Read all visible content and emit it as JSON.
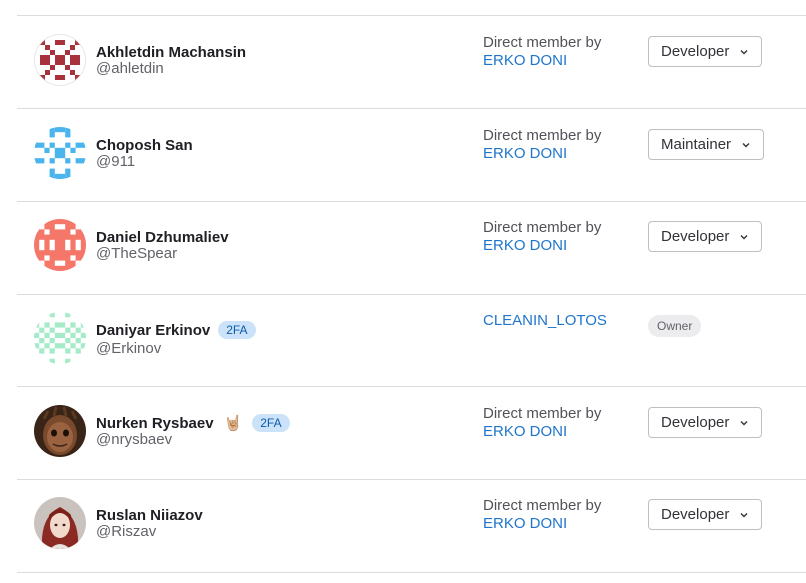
{
  "members": [
    {
      "name": "Akhletdin Machansin",
      "username": "@ahletdin",
      "source_text": "Direct member by",
      "source_link": "ERKO DONI",
      "role": "Developer",
      "badges": [],
      "avatar": "identicon-red-ornament"
    },
    {
      "name": "Choposh San",
      "username": "@911",
      "source_text": "Direct member by",
      "source_link": "ERKO DONI",
      "role": "Maintainer",
      "badges": [],
      "avatar": "identicon-blue-pattern"
    },
    {
      "name": "Daniel Dzhumaliev",
      "username": "@TheSpear",
      "source_text": "Direct member by",
      "source_link": "ERKO DONI",
      "role": "Developer",
      "badges": [],
      "avatar": "identicon-coral-pattern"
    },
    {
      "name": "Daniyar Erkinov",
      "username": "@Erkinov",
      "source_link": "CLEANIN_LOTOS",
      "role_badge": "Owner",
      "badges": [
        "2FA"
      ],
      "avatar": "identicon-mint-checker"
    },
    {
      "name": "Nurken Rysbaev",
      "username": "@nrysbaev",
      "source_text": "Direct member by",
      "source_link": "ERKO DONI",
      "role": "Developer",
      "emoji": "🤘🏼",
      "badges": [
        "2FA"
      ],
      "avatar": "photo-groot"
    },
    {
      "name": "Ruslan Niiazov",
      "username": "@Riszav",
      "source_text": "Direct member by",
      "source_link": "ERKO DONI",
      "role": "Developer",
      "badges": [],
      "avatar": "photo-red-hair"
    }
  ],
  "colors": {
    "link": "#1f75cb",
    "badge_bg": "#cbe2f9",
    "badge_fg": "#0b5cad",
    "border": "#dcdcde"
  }
}
